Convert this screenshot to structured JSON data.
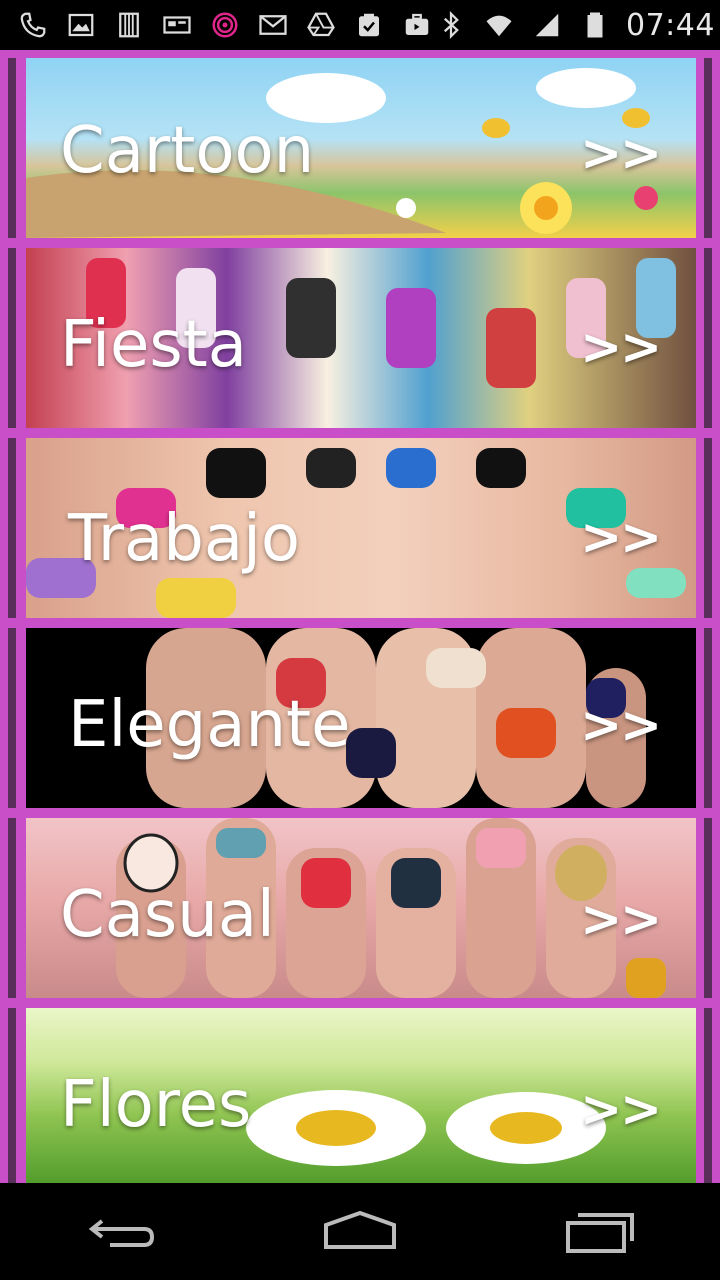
{
  "status_bar": {
    "time": "07:44",
    "icons_left": [
      "phone-icon",
      "image-icon",
      "sd-card-icon",
      "keyboard-icon",
      "target-icon",
      "gmail-icon",
      "drive-icon",
      "clipboard-check-icon",
      "briefcase-icon"
    ],
    "icons_right": [
      "bluetooth-icon",
      "wifi-icon",
      "signal-icon",
      "battery-icon"
    ]
  },
  "categories": [
    {
      "label": "Cartoon",
      "arrow": ">>"
    },
    {
      "label": "Fiesta",
      "arrow": ">>"
    },
    {
      "label": "Trabajo",
      "arrow": ">>"
    },
    {
      "label": "Elegante",
      "arrow": ">>"
    },
    {
      "label": "Casual",
      "arrow": ">>"
    },
    {
      "label": "Flores",
      "arrow": ">>"
    }
  ],
  "nav_bar": {
    "buttons": [
      "back-icon",
      "home-icon",
      "recent-apps-icon"
    ]
  },
  "colors": {
    "list_background": "#c84fc8",
    "row_border": "#5a2e5a",
    "label_text": "#ffffff"
  }
}
